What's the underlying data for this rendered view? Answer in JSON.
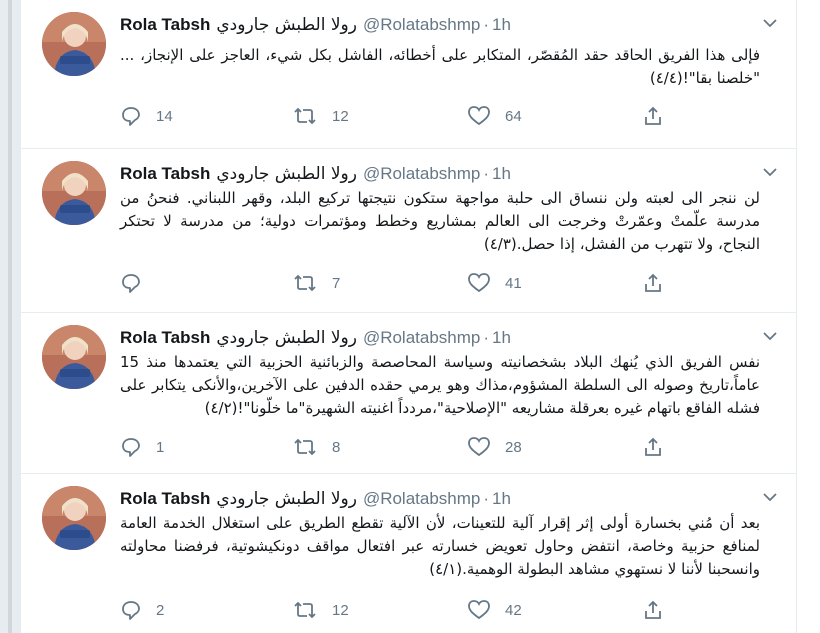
{
  "account": {
    "display_name": "Rola Tabsh",
    "display_name_ar": "رولا الطبش جارودي",
    "handle": "@Rolatabshmp",
    "separator": "·",
    "time": "1h"
  },
  "tweets": [
    {
      "text": "فإلى هذا الفريق الحاقد حقد المُقصّر، المتكابر على أخطائه، الفاشل بكل شيء، العاجز على الإنجاز، ... \"خلصنا بقا\"!(٤/٤)",
      "replies": "14",
      "retweets": "12",
      "likes": "64"
    },
    {
      "text": "لن ننجر الى لعبته ولن ننساق الى حلبة مواجهة ستكون نتيجتها تركيع البلد، وقهر اللبناني. فنحنُ من مدرسة علّمتْ وعمّرتْ وخرجت الى العالم بمشاريع وخطط ومؤتمرات دولية؛ من مدرسة لا تحتكر النجاح، ولا تتهرب من الفشل، إذا حصل.(٤/٣)",
      "replies": "",
      "retweets": "7",
      "likes": "41"
    },
    {
      "text": "نفس الفريق الذي يُنهك البلاد بشخصانيته وسياسة المحاصصة والزبائنية الحزبية التي يعتمدها منذ 15 عاماً،تاريخ وصوله الى السلطة المشؤوم،مذاك وهو يرمي حقده الدفين على الآخرين،والأنكى يتكابر على فشله الفاقع باتهام غيره بعرقلة مشاريعه \"الإصلاحية\"،مردداً اغنيته الشهيرة\"ما خلّونا\"!(٤/٢)",
      "replies": "1",
      "retweets": "8",
      "likes": "28"
    },
    {
      "text": "بعد أن مُني بخسارة أولى إثر إقرار آلية للتعينات، لأن الآلية تقطع الطريق على استغلال الخدمة العامة لمنافع حزبية وخاصة، انتفض وحاول تعويض خسارته عبر افتعال مواقف دونكيشوتية، فرفضنا محاولته وانسحبنا لأننا لا نستهوي مشاهد البطولة الوهمية.(٤/١)",
      "replies": "2",
      "retweets": "12",
      "likes": "42"
    }
  ],
  "icons": {
    "reply": "reply-icon",
    "retweet": "retweet-icon",
    "like": "heart-icon",
    "share": "share-icon",
    "caret": "chevron-down-icon"
  },
  "colors": {
    "text": "#14171a",
    "muted": "#657786",
    "border": "#e6ecf0",
    "gutter": "#e6ecf0"
  }
}
